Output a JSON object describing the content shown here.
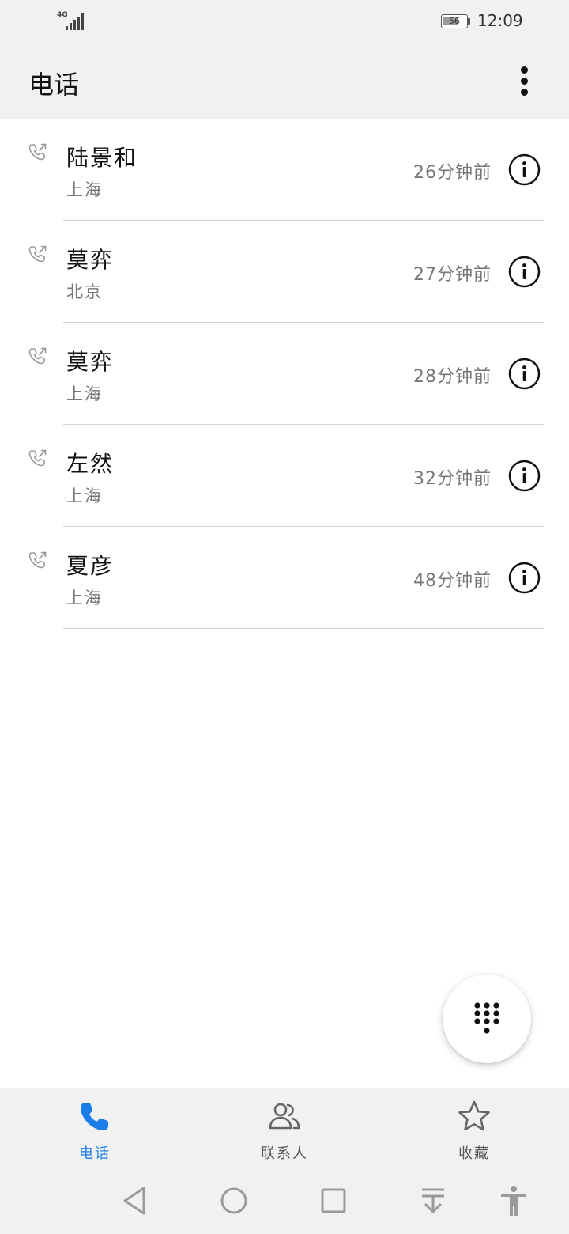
{
  "status_bar": {
    "network": "4G",
    "battery_level": "56",
    "time": "12:09"
  },
  "app_bar": {
    "title": "电话",
    "more_icon": "more-vertical-icon"
  },
  "calls": [
    {
      "name": "陆景和",
      "location": "上海",
      "time": "26分钟前",
      "type_icon": "outgoing-call-icon"
    },
    {
      "name": "莫弈",
      "location": "北京",
      "time": "27分钟前",
      "type_icon": "outgoing-call-icon"
    },
    {
      "name": "莫弈",
      "location": "上海",
      "time": "28分钟前",
      "type_icon": "outgoing-call-icon"
    },
    {
      "name": "左然",
      "location": "上海",
      "time": "32分钟前",
      "type_icon": "outgoing-call-icon"
    },
    {
      "name": "夏彦",
      "location": "上海",
      "time": "48分钟前",
      "type_icon": "outgoing-call-icon"
    }
  ],
  "dialpad_fab": {
    "icon": "dialpad-icon"
  },
  "bottom_nav": {
    "tabs": [
      {
        "label": "电话",
        "icon": "phone-icon",
        "active": true
      },
      {
        "label": "联系人",
        "icon": "contacts-icon",
        "active": false
      },
      {
        "label": "收藏",
        "icon": "star-icon",
        "active": false
      }
    ]
  },
  "system_nav": [
    "back-icon",
    "home-icon",
    "recents-icon",
    "notification-pull-icon",
    "accessibility-icon"
  ],
  "colors": {
    "accent": "#1a7ee6",
    "bar_background": "#f1f1f1",
    "secondary_text": "#777777"
  }
}
